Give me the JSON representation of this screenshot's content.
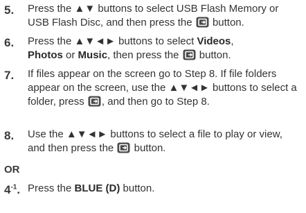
{
  "steps": [
    {
      "number": "5.",
      "text_a": "Press the ▲▼ buttons to select USB Flash Memory or USB Flash Disc, and then press the ",
      "text_b": " button.",
      "icon": "enter-button-icon"
    },
    {
      "number": "6.",
      "text_a": "Press the ▲▼◄► buttons to select ",
      "bold_1": "Videos",
      "sep_1": ", ",
      "bold_2": "Photos",
      "sep_2": " or ",
      "bold_3": "Music",
      "text_b": ", then press the ",
      "text_c": " button.",
      "icon": "enter-button-icon"
    },
    {
      "number": "7.",
      "text_a": "If files appear on the screen go to Step 8. If file folders appear on the screen, use the ▲▼◄► buttons to select a folder, press ",
      "text_b": ", and then go to Step 8.",
      "icon": "enter-button-icon"
    },
    {
      "number": "8.",
      "text_a": "Use the ▲▼◄► buttons to select a file to play or view, and then press the ",
      "text_b": " button.",
      "icon": "enter-button-icon"
    }
  ],
  "or_label": "OR",
  "alt_step": {
    "number": "4",
    "number_sup": "-1",
    "number_suffix": ".",
    "text_a": "Press the ",
    "bold": "BLUE (D)",
    "text_b": " button."
  },
  "colors": {
    "icon_bg": "#4a4a4a",
    "text": "#333333"
  }
}
